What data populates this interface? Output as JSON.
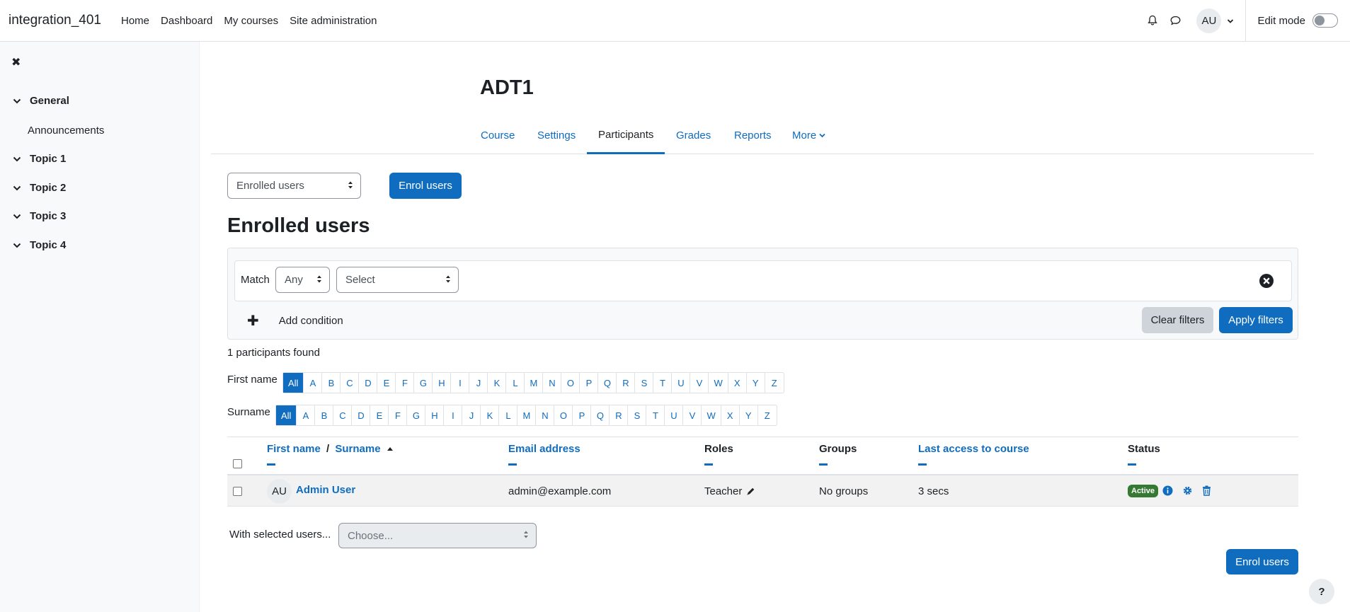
{
  "navbar": {
    "brand": "integration_401",
    "links": [
      "Home",
      "Dashboard",
      "My courses",
      "Site administration"
    ],
    "avatar_initials": "AU",
    "edit_mode_label": "Edit mode"
  },
  "drawer": {
    "sections": [
      {
        "label": "General",
        "items": [
          "Announcements"
        ]
      },
      {
        "label": "Topic 1"
      },
      {
        "label": "Topic 2"
      },
      {
        "label": "Topic 3"
      },
      {
        "label": "Topic 4"
      }
    ]
  },
  "course": {
    "title": "ADT1",
    "tabs": [
      "Course",
      "Settings",
      "Participants",
      "Grades",
      "Reports",
      "More"
    ],
    "active_tab": "Participants"
  },
  "participants": {
    "view_select": "Enrolled users",
    "enrol_button": "Enrol users",
    "heading": "Enrolled users",
    "filter": {
      "match_label": "Match",
      "match_value": "Any",
      "type_value": "Select",
      "add_condition": "Add condition",
      "clear_filters": "Clear filters",
      "apply_filters": "Apply filters"
    },
    "found_text": "1 participants found",
    "firstname_label": "First name",
    "surname_label": "Surname",
    "letters": [
      "All",
      "A",
      "B",
      "C",
      "D",
      "E",
      "F",
      "G",
      "H",
      "I",
      "J",
      "K",
      "L",
      "M",
      "N",
      "O",
      "P",
      "Q",
      "R",
      "S",
      "T",
      "U",
      "V",
      "W",
      "X",
      "Y",
      "Z"
    ],
    "columns": {
      "firstname": "First name",
      "separator": "/",
      "surname": "Surname",
      "email": "Email address",
      "roles": "Roles",
      "groups": "Groups",
      "last_access": "Last access to course",
      "status": "Status"
    },
    "rows": [
      {
        "initials": "AU",
        "name": "Admin User",
        "email": "admin@example.com",
        "role": "Teacher",
        "groups": "No groups",
        "last_access": "3 secs",
        "status": "Active"
      }
    ],
    "bulk_label": "With selected users...",
    "bulk_select": "Choose...",
    "enrol_button_bottom": "Enrol users"
  },
  "help": "?",
  "colors": {
    "primary": "#0f6cbf",
    "success": "#357a32",
    "text": "#1d2125"
  }
}
